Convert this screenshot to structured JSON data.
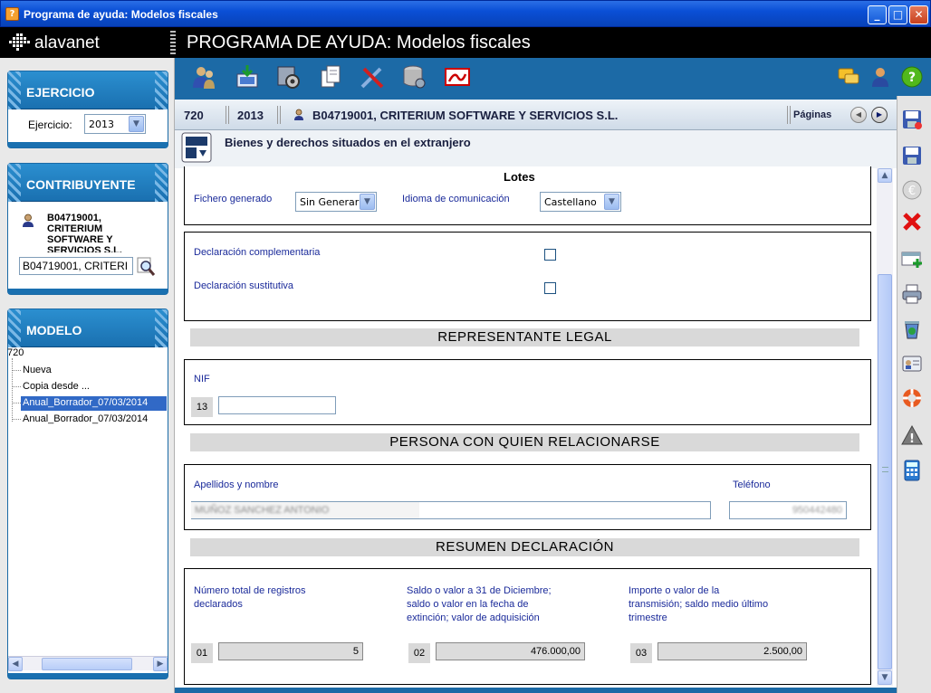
{
  "window": {
    "title": "Programa de ayuda: Modelos fiscales"
  },
  "header": {
    "logo_text": "alavanet",
    "title": "PROGRAMA DE AYUDA: Modelos fiscales"
  },
  "ejercicio": {
    "heading": "EJERCICIO",
    "label": "Ejercicio:",
    "value": "2013"
  },
  "contribuyente": {
    "heading": "CONTRIBUYENTE",
    "name_lines": [
      "B04719001,",
      "CRITERIUM",
      "SOFTWARE Y",
      "SERVICIOS S.L."
    ],
    "search_value": "B04719001, CRITERI"
  },
  "modelo": {
    "heading": "MODELO",
    "root": "720",
    "items": [
      "Nueva",
      "Copia desde ...",
      "Anual_Borrador_07/03/2014",
      "Anual_Borrador_07/03/2014"
    ],
    "selected_index": 2
  },
  "docinfo": {
    "modelo": "720",
    "ejercicio": "2013",
    "contribuyente": "B04719001, CRITERIUM SOFTWARE Y SERVICIOS S.L.",
    "paginas": "Páginas"
  },
  "section_title": "Bienes y derechos situados en el extranjero",
  "lotes": {
    "heading": "Lotes",
    "fichero_label": "Fichero generado",
    "fichero_value": "Sin Generar",
    "idioma_label": "Idioma de comunicación",
    "idioma_value": "Castellano"
  },
  "declaracion": {
    "complementaria": "Declaración complementaria",
    "sustitutiva": "Declaración sustitutiva"
  },
  "representante": {
    "heading": "REPRESENTANTE LEGAL",
    "nif_label": "NIF",
    "nif_num": "13",
    "nif_value": ""
  },
  "persona": {
    "heading": "PERSONA CON QUIEN RELACIONARSE",
    "nombre_label": "Apellidos y nombre",
    "nombre_value": "MUÑOZ SANCHEZ ANTONIO",
    "telefono_label": "Teléfono",
    "telefono_value": "950442480"
  },
  "resumen": {
    "heading": "RESUMEN DECLARACIÓN",
    "f1_label_1": "Número total de registros",
    "f1_label_2": "declarados",
    "f2_label_1": "Saldo o valor a 31 de Diciembre;",
    "f2_label_2": "saldo o valor en la fecha de",
    "f2_label_3": "extinción; valor de adquisición",
    "f3_label_1": "Importe o valor de la",
    "f3_label_2": "transmisión; saldo medio último",
    "f3_label_3": "trimestre",
    "f1_num": "01",
    "f1_value": "5",
    "f2_num": "02",
    "f2_value": "476.000,00",
    "f3_num": "03",
    "f3_value": "2.500,00"
  }
}
